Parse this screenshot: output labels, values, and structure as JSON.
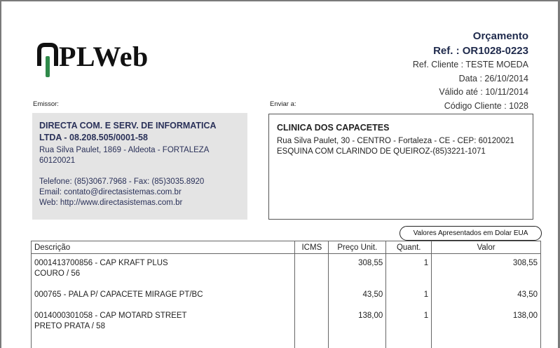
{
  "logo": {
    "text": "PLWeb",
    "icon": "pl-logo-mark"
  },
  "header": {
    "title": "Orçamento",
    "ref": "Ref. : OR1028-0223",
    "ref_cliente": "Ref. Cliente : TESTE MOEDA",
    "data": "Data : 26/10/2014",
    "valido": "Válido até : 10/11/2014",
    "codigo": "Código Cliente : 1028"
  },
  "emissor": {
    "label": "Emissor:",
    "name": "DIRECTA COM. E SERV. DE INFORMATICA LTDA  - 08.208.505/0001-58",
    "address": "Rua Silva Paulet, 1869 - Aldeota -  FORTALEZA 60120021",
    "phone": "Telefone: (85)3067.7968 - Fax: (85)3035.8920",
    "email": "Email: contato@directasistemas.com.br",
    "web": "Web: http://www.directasistemas.com.br"
  },
  "enviar": {
    "label": "Enviar a:",
    "name": "CLINICA DOS CAPACETES",
    "address": "Rua Silva Paulet, 30 - CENTRO - Fortaleza - CE - CEP: 60120021  ESQUINA COM CLARINDO DE QUEIROZ-(85)3221-1071"
  },
  "currency_note": "Valores Apresentados em Dolar EUA",
  "table": {
    "headers": {
      "descricao": "Descrição",
      "icms": "ICMS",
      "preco": "Preço Unit.",
      "quant": "Quant.",
      "valor": "Valor"
    },
    "rows": [
      {
        "desc1": "0001413700856 - CAP KRAFT PLUS",
        "desc2": "COURO / 56",
        "icms": "",
        "preco": "308,55",
        "quant": "1",
        "valor": "308,55"
      },
      {
        "desc1": "000765 - PALA P/ CAPACETE MIRAGE PT/BC",
        "desc2": "",
        "icms": "",
        "preco": "43,50",
        "quant": "1",
        "valor": "43,50"
      },
      {
        "desc1": "0014000301058 - CAP MOTARD STREET",
        "desc2": "PRETO PRATA / 58",
        "icms": "",
        "preco": "138,00",
        "quant": "1",
        "valor": "138,00"
      }
    ]
  }
}
